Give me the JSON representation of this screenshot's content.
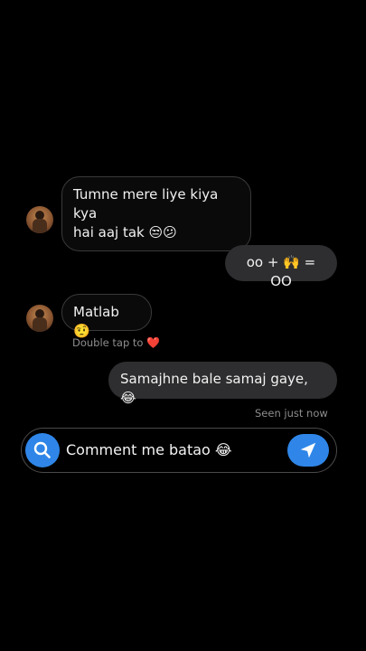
{
  "messages": [
    {
      "sender": "other",
      "text_line1": "Tumne mere liye kiya kya",
      "text_line2": "hai aaj tak 😒😕"
    },
    {
      "sender": "me",
      "text": "oo + 🙌 = OO"
    },
    {
      "sender": "other",
      "text": "Matlab 🤨"
    },
    {
      "sender": "me",
      "text": "Samajhne bale samaj gaye, 😂"
    }
  ],
  "hints": {
    "double_tap": "Double tap to",
    "heart": "❤️",
    "seen": "Seen just now"
  },
  "composer": {
    "text": "Comment me batao 😂",
    "search_icon": "search-icon",
    "send_icon": "send-icon"
  },
  "colors": {
    "accent": "#2f86e8",
    "outgoing_bubble": "#2e2e30",
    "incoming_border": "#3a3a3a",
    "background": "#000000"
  }
}
